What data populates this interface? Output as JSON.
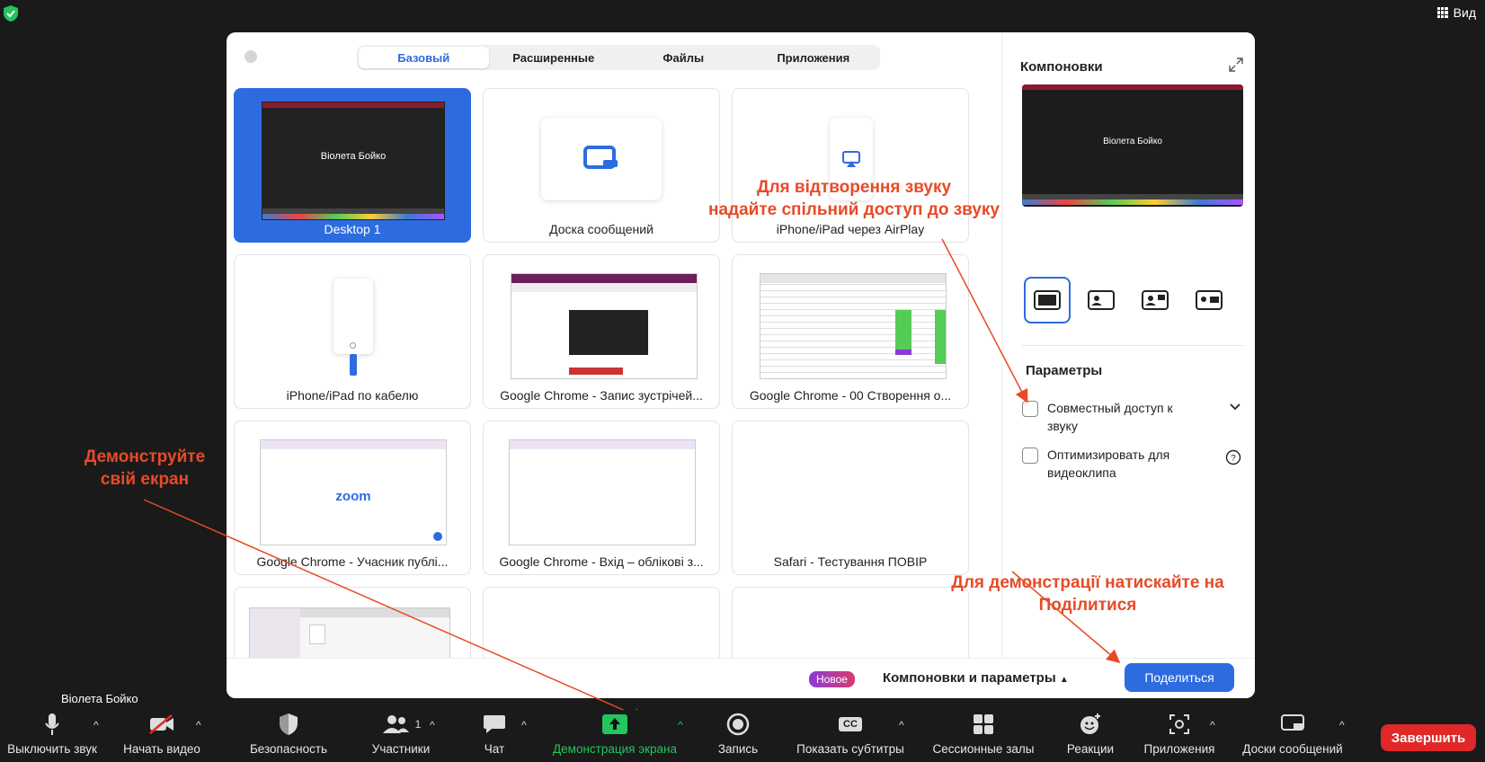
{
  "top": {
    "view_label": "Вид"
  },
  "name_tag": "Віолета Бойко",
  "dialog": {
    "tabs": [
      "Базовый",
      "Расширенные",
      "Файлы",
      "Приложения"
    ],
    "tiles": [
      {
        "label": "Desktop 1"
      },
      {
        "label": "Доска сообщений"
      },
      {
        "label": "iPhone/iPad через AirPlay"
      },
      {
        "label": "iPhone/iPad по кабелю"
      },
      {
        "label": "Google Chrome - Запис зустрічей..."
      },
      {
        "label": "Google Chrome - 00 Створення о..."
      },
      {
        "label": "Google Chrome - Учасник публі..."
      },
      {
        "label": "Google Chrome - Вхід – облікові з..."
      },
      {
        "label": "Safari - Тестування ПОВІР"
      }
    ],
    "desktop_name": "Віолета Бойко",
    "zoom_logo": "zoom",
    "sidebar": {
      "title": "Компоновки",
      "preview_name": "Віолета Бойко",
      "params_title": "Параметры",
      "option_audio": "Совместный доступ к звуку",
      "option_video": "Оптимизировать для видеоклипа"
    },
    "footer": {
      "new_badge": "Новое",
      "layouts_params": "Компоновки и параметры",
      "share_button": "Поделиться"
    }
  },
  "annotations": {
    "audio_note": [
      "Для  відтворення звуку",
      "надайте спільний доступ до звуку"
    ],
    "screen_note": [
      "Демонструйте",
      "свій екран"
    ],
    "share_note": [
      "Для демонстрації натискайте на",
      "Поділитися"
    ]
  },
  "toolbar": {
    "mute": "Выключить звук",
    "video": "Начать видео",
    "security": "Безопасность",
    "participants": "Участники",
    "participants_count": "1",
    "chat": "Чат",
    "share_screen": "Демонстрация экрана",
    "record": "Запись",
    "captions": "Показать субтитры",
    "captions_icon": "CC",
    "breakout": "Сессионные залы",
    "reactions": "Реакции",
    "apps": "Приложения",
    "whiteboards": "Доски сообщений",
    "end": "Завершить"
  },
  "colors": {
    "accent": "#2d6cdf",
    "annotation": "#e94a26",
    "share_green": "#22c55e",
    "end_red": "#e02828"
  }
}
